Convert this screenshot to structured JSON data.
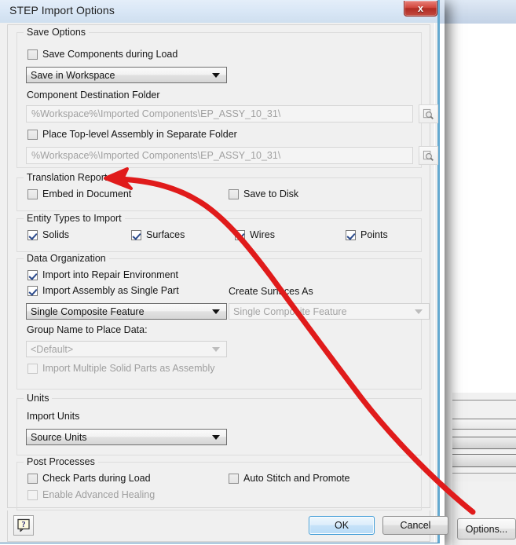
{
  "window": {
    "title": "STEP Import Options",
    "close_icon": "close-x-icon"
  },
  "groups": {
    "save_options": {
      "legend": "Save Options",
      "save_components_checkbox": {
        "label": "Save Components during Load",
        "checked": false
      },
      "save_location_combo": {
        "value": "Save in Workspace"
      },
      "component_destination_label": "Component Destination Folder",
      "component_destination_field": {
        "value": "%Workspace%\\Imported Components\\EP_ASSY_10_31\\"
      },
      "component_browse_icon": "browse-folder-icon",
      "place_toplevel_checkbox": {
        "label": "Place Top-level Assembly in Separate Folder",
        "checked": false
      },
      "toplevel_folder_field": {
        "value": "%Workspace%\\Imported Components\\EP_ASSY_10_31\\"
      },
      "toplevel_browse_icon": "browse-folder-icon"
    },
    "translation_report": {
      "legend": "Translation Report",
      "embed_checkbox": {
        "label": "Embed in Document",
        "checked": false
      },
      "save_to_disk_checkbox": {
        "label": "Save to Disk",
        "checked": false
      }
    },
    "entity_types": {
      "legend": "Entity Types to Import",
      "solids_checkbox": {
        "label": "Solids",
        "checked": true
      },
      "surfaces_checkbox": {
        "label": "Surfaces",
        "checked": true
      },
      "wires_checkbox": {
        "label": "Wires",
        "checked": true
      },
      "points_checkbox": {
        "label": "Points",
        "checked": true
      }
    },
    "data_organization": {
      "legend": "Data Organization",
      "repair_env_checkbox": {
        "label": "Import into Repair Environment",
        "checked": true
      },
      "single_part_checkbox": {
        "label": "Import Assembly as Single Part",
        "checked": true
      },
      "assembly_combo": {
        "value": "Single Composite Feature"
      },
      "create_surfaces_label": "Create Surfaces As",
      "create_surfaces_combo": {
        "value": "Single Composite Feature",
        "disabled": true
      },
      "group_name_label": "Group Name to Place Data:",
      "group_name_combo": {
        "value": "<Default>",
        "disabled": true
      },
      "multiple_solid_checkbox": {
        "label": "Import Multiple Solid Parts as Assembly",
        "checked": false,
        "disabled": true
      }
    },
    "units": {
      "legend": "Units",
      "import_units_label": "Import Units",
      "import_units_combo": {
        "value": "Source Units"
      }
    },
    "post_processes": {
      "legend": "Post Processes",
      "check_parts_checkbox": {
        "label": "Check Parts during Load",
        "checked": false
      },
      "auto_stitch_checkbox": {
        "label": "Auto Stitch and Promote",
        "checked": false
      },
      "advanced_healing_checkbox": {
        "label": "Enable Advanced Healing",
        "checked": false,
        "disabled": true
      }
    }
  },
  "buttonbar": {
    "help_icon": "help-question-icon",
    "ok_label": "OK",
    "cancel_label": "Cancel"
  },
  "background_app": {
    "options_label": "Options..."
  },
  "annotation": {
    "type": "hand-drawn-arrow",
    "color": "#e01b1b",
    "points_to": "Translation Report"
  }
}
